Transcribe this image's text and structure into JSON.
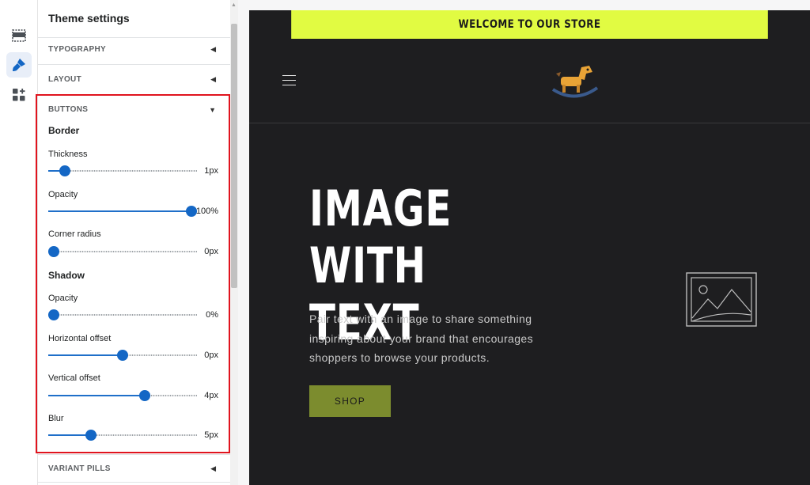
{
  "sidebar": {
    "title": "Theme settings",
    "rail_icons": [
      "sections-icon",
      "theme-settings-brush-icon",
      "app-blocks-icon"
    ]
  },
  "sections": {
    "typography": "TYPOGRAPHY",
    "layout": "LAYOUT",
    "buttons": "BUTTONS",
    "variant_pills": "VARIANT PILLS"
  },
  "buttons": {
    "border_heading": "Border",
    "shadow_heading": "Shadow",
    "sliders": [
      {
        "label": "Thickness",
        "value": "1px",
        "fraction": 0.08
      },
      {
        "label": "Opacity",
        "value": "100%",
        "fraction": 1.0
      },
      {
        "label": "Corner radius",
        "value": "0px",
        "fraction": 0.0
      },
      {
        "label": "Opacity",
        "value": "0%",
        "fraction": 0.0
      },
      {
        "label": "Horizontal offset",
        "value": "0px",
        "fraction": 0.5
      },
      {
        "label": "Vertical offset",
        "value": "4px",
        "fraction": 0.66
      },
      {
        "label": "Blur",
        "value": "5px",
        "fraction": 0.27
      }
    ]
  },
  "preview": {
    "announcement": "WELCOME TO OUR STORE",
    "hero_title_line1": "IMAGE WITH",
    "hero_title_line2": "TEXT",
    "hero_text": "Pair text with an image to share something inspiring about your brand that encourages shoppers to browse your products.",
    "button_label": "SHOP"
  },
  "colors": {
    "accent_blue": "#1467c5",
    "announcement_bg": "#e1fb42",
    "store_bg": "#1e1e20",
    "shop_button": "#7c8c2e",
    "highlight_border": "#e0141e"
  }
}
